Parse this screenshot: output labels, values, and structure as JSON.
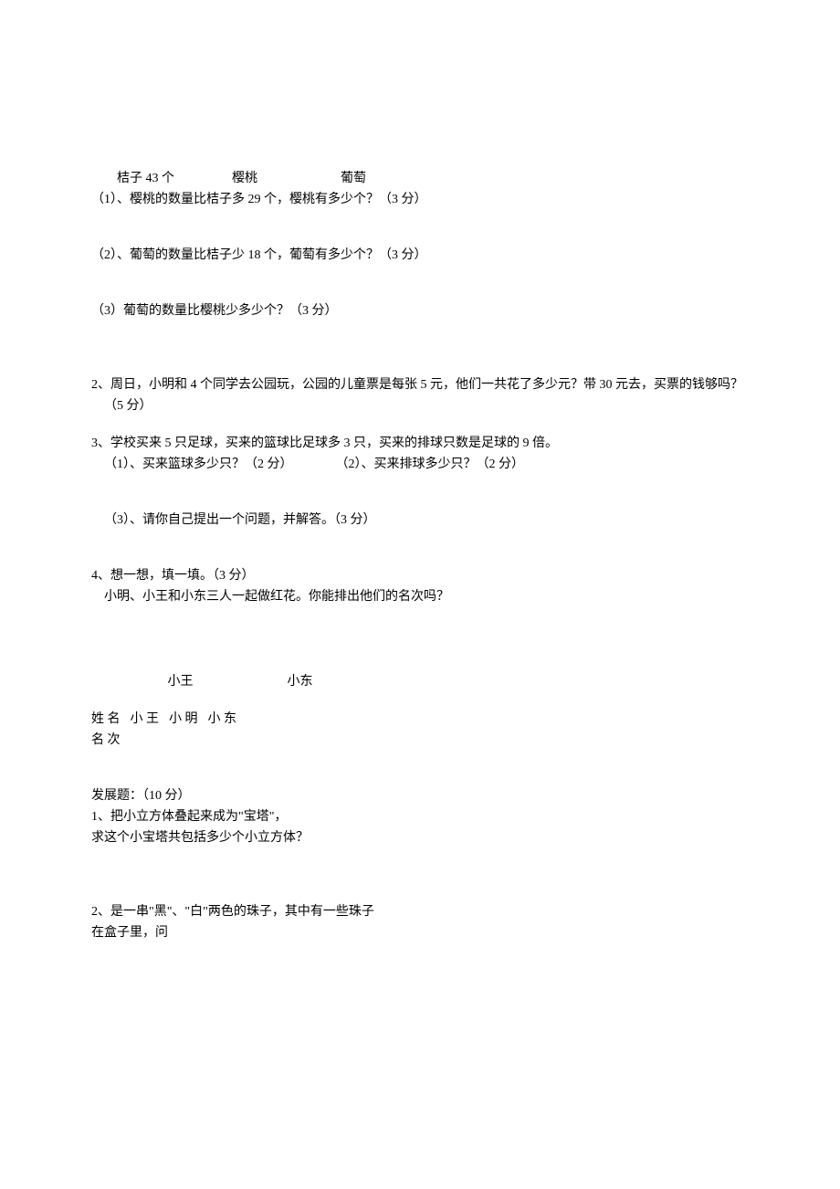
{
  "fruit": {
    "orange_label": "桔子 43 个",
    "cherry_label": "樱桃",
    "grape_label": "葡萄",
    "q1": "（1）、樱桃的数量比桔子多 29 个，樱桃有多少个？（3 分）",
    "q2": "（2）、葡萄的数量比桔子少 18 个，葡萄有多少个？（3 分）",
    "q3": "（3）葡萄的数量比樱桃少多少个？（3 分）"
  },
  "q2_line1": "2、周日，小明和 4 个同学去公园玩，公园的儿童票是每张 5 元，他们一共花了多少元？带 30 元去，买票的钱够吗？",
  "q2_line2": "（5 分）",
  "q3_line1": "3、学校买来 5 只足球，买来的篮球比足球多 3 只，买来的排球只数是足球的 9 倍。",
  "q3_sub1": "（1）、买来篮球多少只？（2 分）",
  "q3_sub2": "（2）、买来排球多少只？（2 分）",
  "q3_sub3": "（3）、请你自己提出一个问题，并解答。（3 分）",
  "q4_line1": "4、想一想，填一填。（3 分）",
  "q4_line2": "小明、小王和小东三人一起做红花。你能排出他们的名次吗？",
  "q4_names_wang": "小王",
  "q4_names_dong": "小东",
  "q4_table_header_label": "姓  名",
  "q4_table_header_c1": "小  王",
  "q4_table_header_c2": "小  明",
  "q4_table_header_c3": "小  东",
  "q4_table_row2_label": "名  次",
  "ext_title": "发展题：（10 分）",
  "ext_q1_line1": "1、把小立方体叠起来成为\"宝塔\"，",
  "ext_q1_line2": "求这个小宝塔共包括多少个小立方体？",
  "ext_q2_line1": "2、是一串\"黑\"、\"白\"两色的珠子，其中有一些珠子",
  "ext_q2_line2": "在盒子里，问"
}
